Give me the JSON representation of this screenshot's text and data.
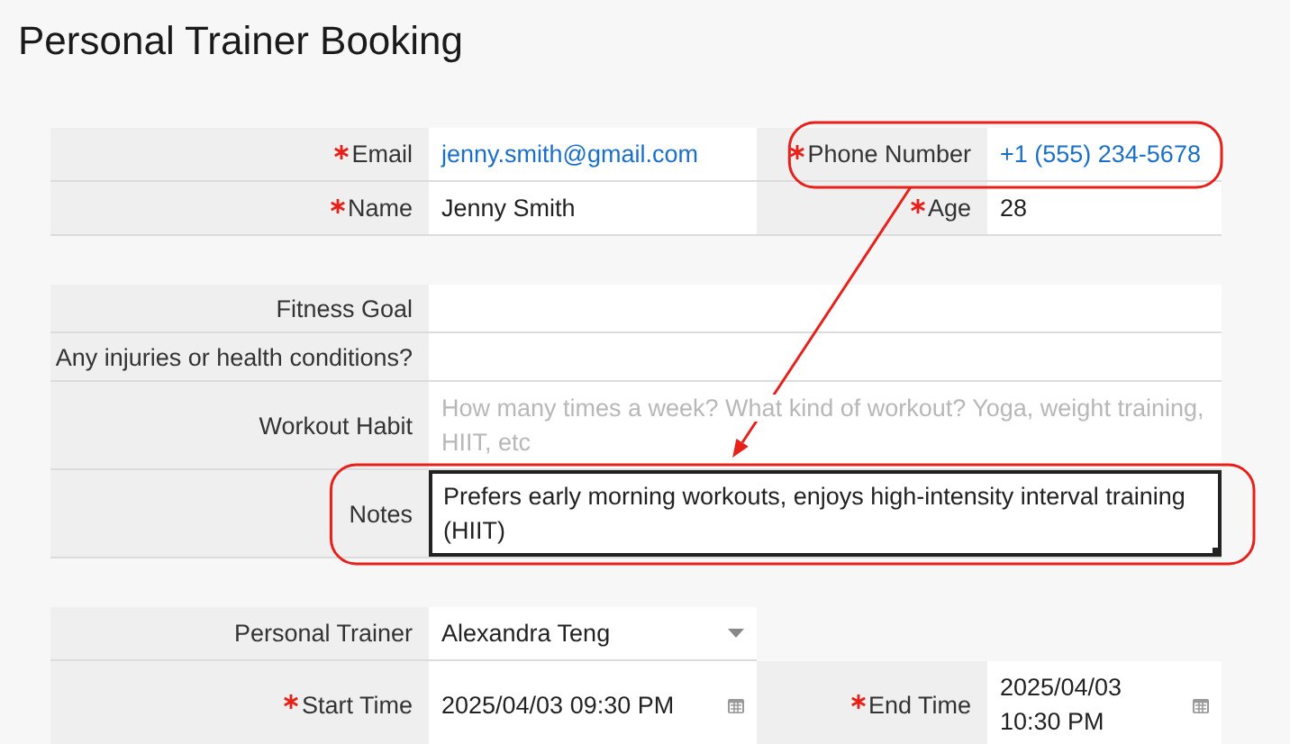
{
  "title": "Personal Trainer Booking",
  "sections": [
    {
      "rows": [
        [
          {
            "label": "Email",
            "required": true,
            "kind": "link",
            "value": "jenny.smith@gmail.com",
            "focused": false,
            "highlighted": false
          },
          {
            "label": "Phone Number",
            "required": true,
            "kind": "link",
            "value": "+1 (555) 234-5678",
            "focused": false,
            "highlighted": true
          }
        ],
        [
          {
            "label": "Name",
            "required": true,
            "kind": "text",
            "value": "Jenny Smith",
            "focused": false,
            "highlighted": false
          },
          {
            "label": "Age",
            "required": true,
            "kind": "text",
            "value": "28",
            "focused": false,
            "highlighted": false
          }
        ]
      ]
    },
    {
      "rows": [
        [
          {
            "label": "Fitness Goal",
            "required": false,
            "kind": "text",
            "focused": false,
            "highlighted": false
          }
        ],
        [
          {
            "label": "Any injuries or health conditions?",
            "required": false,
            "kind": "text",
            "focused": false,
            "highlighted": false
          }
        ],
        [
          {
            "label": "Workout Habit",
            "required": false,
            "kind": "textarea",
            "placeholder": "How many times a week? What kind of workout? Yoga, weight training, HIIT, etc",
            "focused": false,
            "highlighted": false
          }
        ],
        [
          {
            "label": "Notes",
            "required": false,
            "kind": "textarea",
            "value": "Prefers early morning workouts, enjoys high-intensity interval training (HIIT)",
            "focused": true,
            "highlighted": true
          }
        ]
      ]
    },
    {
      "rows": [
        [
          {
            "label": "Personal Trainer",
            "required": false,
            "kind": "select",
            "value": "Alexandra Teng",
            "focused": false,
            "highlighted": false
          }
        ],
        [
          {
            "label": "Start Time",
            "required": true,
            "kind": "datetime",
            "value": "2025/04/03 09:30 PM",
            "focused": false,
            "highlighted": false
          },
          {
            "label": "End Time",
            "required": true,
            "kind": "datetime",
            "value": "2025/04/03 10:30 PM",
            "focused": false,
            "highlighted": false
          }
        ]
      ]
    }
  ]
}
